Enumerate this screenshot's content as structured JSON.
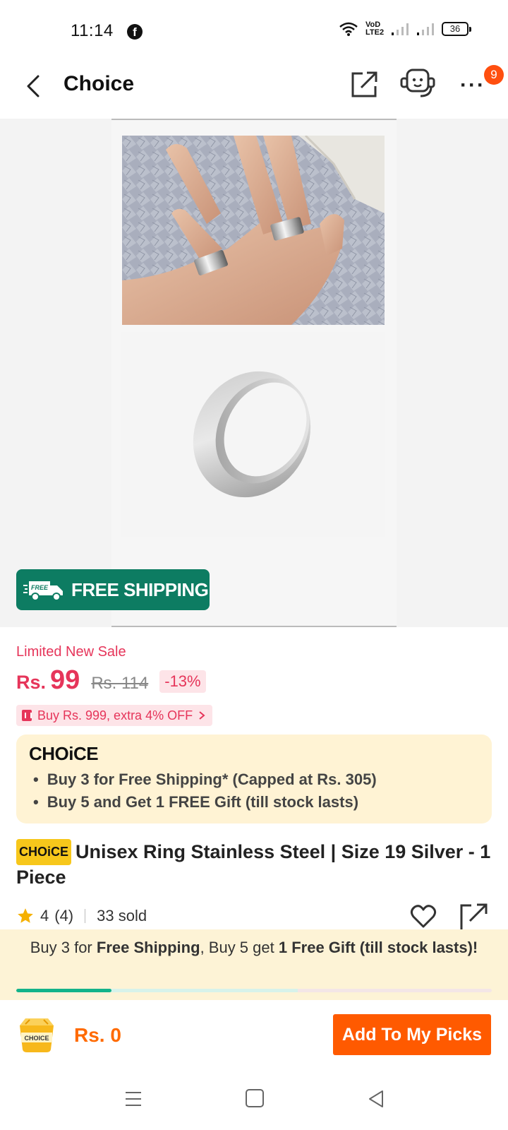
{
  "status_bar": {
    "time": "11:14",
    "volte": "VoD LTE2",
    "battery": "36"
  },
  "header": {
    "title": "Choice",
    "notification_count": "9"
  },
  "gallery": {
    "badge_label": "FREE SHIPPING",
    "truck_label": "FREE"
  },
  "price": {
    "sale_label": "Limited New Sale",
    "currency": "Rs.",
    "current": "99",
    "original": "Rs. 114",
    "discount": "-13%",
    "coupon": "Buy Rs. 999, extra 4% OFF"
  },
  "choice_card": {
    "logo": "CHOiCE",
    "benefits": [
      "Buy 3 for  Free Shipping* (Capped at Rs. 305)",
      "Buy 5 and Get 1 FREE Gift (till stock lasts)"
    ]
  },
  "product": {
    "badge": "CHOiCE",
    "title": "Unisex Ring Stainless Steel | Size 19 Silver - 1 Piece",
    "rating": "4",
    "reviews": "(4)",
    "sold": "33 sold"
  },
  "promo": {
    "part1": "Buy 3 for ",
    "bold1": "Free Shipping",
    "part2": ", Buy 5 get ",
    "bold2": "1 Free Gift (till stock lasts)!",
    "progress": 0.2
  },
  "bottom_bar": {
    "cart_label": "CHOICE",
    "total": "Rs. 0",
    "add_button": "Add To My Picks"
  },
  "colors": {
    "accent": "#ff5a00",
    "price": "#e6355a",
    "free_shipping": "#0d7c62",
    "choice_yellow": "#f7c71b"
  }
}
